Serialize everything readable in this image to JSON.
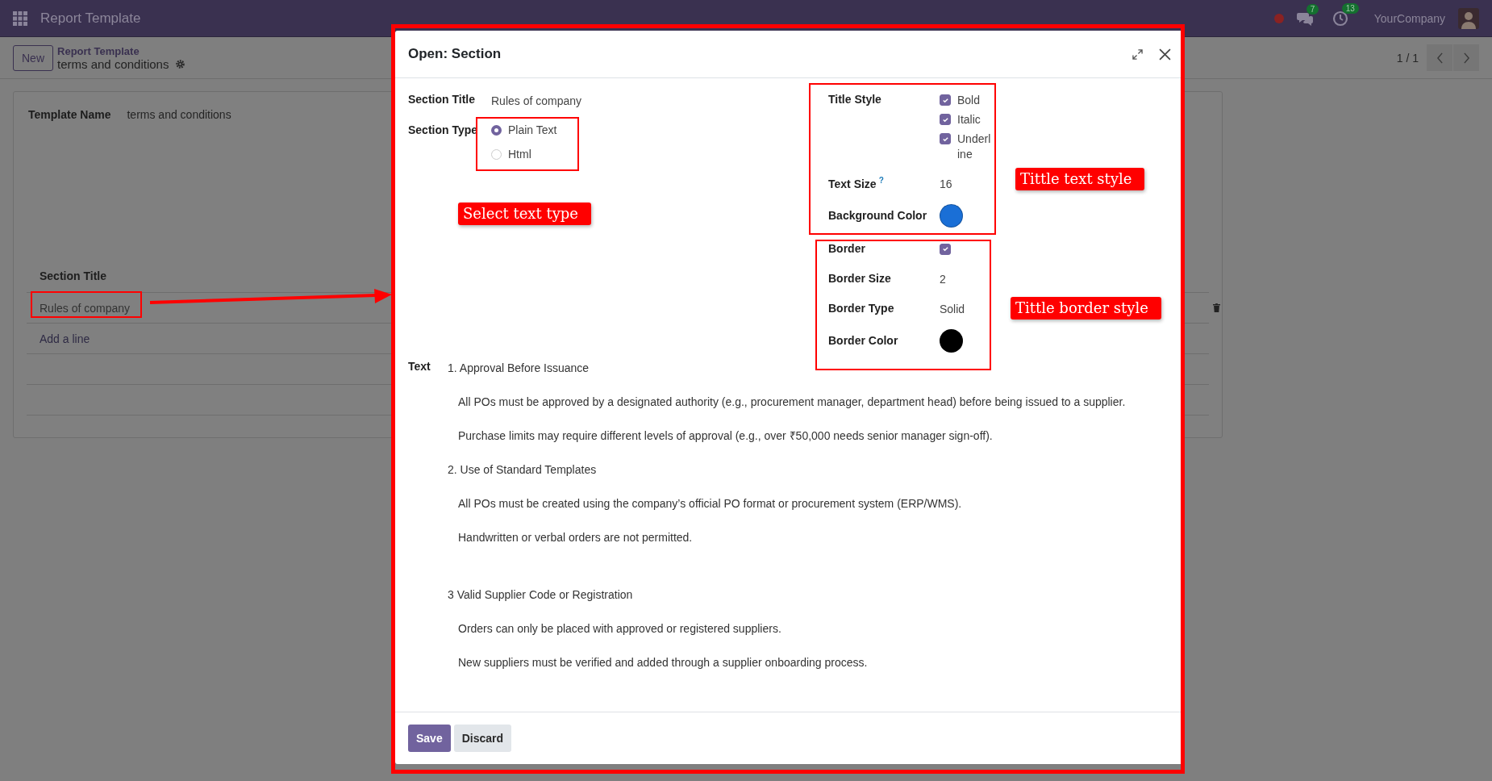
{
  "top_bar": {
    "app_name": "Report Template",
    "chat_count": "7",
    "activity_count": "13",
    "company": "YourCompany"
  },
  "control_panel": {
    "new_button": "New",
    "breadcrumb": "Report Template",
    "record": "terms and conditions",
    "pager": "1 / 1"
  },
  "form": {
    "template_name_label": "Template Name",
    "template_name": "terms and conditions",
    "lines_column": "Section Title",
    "lines": [
      "Rules of company"
    ],
    "add_line": "Add a line"
  },
  "dialog": {
    "title": "Open: Section",
    "section_title_label": "Section Title",
    "section_title": "Rules of company",
    "section_type_label": "Section Type",
    "section_types": [
      {
        "label": "Plain Text",
        "selected": true
      },
      {
        "label": "Html",
        "selected": false
      }
    ],
    "title_style_label": "Title Style",
    "title_styles": [
      {
        "label": "Bold",
        "checked": true
      },
      {
        "label": "Italic",
        "checked": true
      },
      {
        "label": "Underline",
        "checked": true
      }
    ],
    "text_size_label": "Text Size",
    "text_size_help": "?",
    "text_size": "16",
    "background_color_label": "Background Color",
    "background_color": {
      "color": "#1a6fd6"
    },
    "border_label": "Border",
    "border": true,
    "border_size_label": "Border Size",
    "border_size": "2",
    "border_type_label": "Border Type",
    "border_type": "Solid",
    "border_color_label": "Border Color",
    "border_color": {
      "color": "#000000"
    },
    "text_label": "Text",
    "text": [
      {
        "kind": "heading",
        "text": "1. Approval Before Issuance"
      },
      {
        "kind": "item",
        "text": "All POs must be approved by a designated authority (e.g., procurement manager, department head) before being issued to a supplier."
      },
      {
        "kind": "item",
        "text": "Purchase limits may require different levels of approval (e.g., over ₹50,000 needs senior manager sign-off)."
      },
      {
        "kind": "heading",
        "text": "2. Use of Standard Templates"
      },
      {
        "kind": "item",
        "text": "All POs must be created using the company’s official PO format or procurement system (ERP/WMS)."
      },
      {
        "kind": "item",
        "text": "Handwritten or verbal orders are not permitted."
      },
      {
        "kind": "spacer"
      },
      {
        "kind": "heading",
        "text": "3 Valid Supplier Code or Registration"
      },
      {
        "kind": "item",
        "text": "Orders can only be placed with approved or registered suppliers."
      },
      {
        "kind": "item",
        "text": "New suppliers must be verified and added through a supplier onboarding process."
      }
    ],
    "buttons": [
      {
        "label": "Save",
        "kind": "primary"
      },
      {
        "label": "Discard",
        "kind": "secondary"
      }
    ]
  },
  "annotations": [
    {
      "text": "Select text type"
    },
    {
      "text": "Tittle text style"
    },
    {
      "text": "Tittle border style"
    }
  ]
}
